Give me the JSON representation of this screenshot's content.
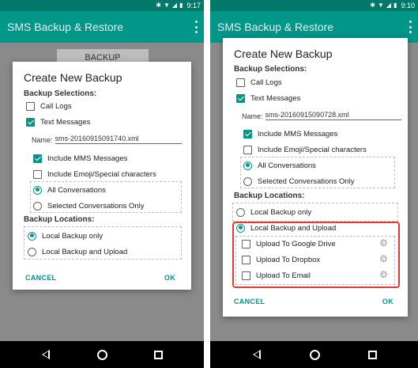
{
  "statusbar": {
    "left_time": "9:17",
    "right_time": "9:10"
  },
  "app": {
    "title": "SMS Backup & Restore",
    "behind_button": "BACKUP"
  },
  "dialog": {
    "title": "Create New Backup",
    "backup_selections": "Backup Selections:",
    "call_logs": "Call Logs",
    "text_messages": "Text Messages",
    "name_label": "Name:",
    "include_mms": "Include MMS Messages",
    "include_emoji": "Include Emoji/Special characters",
    "all_conversations": "All Conversations",
    "selected_conversations": "Selected Conversations Only",
    "backup_locations": "Backup Locations:",
    "local_backup_only": "Local Backup only",
    "local_backup_and_upload": "Local Backup and Upload",
    "upload_google_drive": "Upload To Google Drive",
    "upload_dropbox": "Upload To Dropbox",
    "upload_email": "Upload To Email",
    "cancel": "CANCEL",
    "ok": "OK"
  },
  "left": {
    "name_value": "sms-20160915091740.xml"
  },
  "right": {
    "name_value": "sms-20160915090728.xml"
  },
  "colors": {
    "accent": "#009688",
    "toolbar": "#009688",
    "statusbar": "#00796b",
    "highlight": "#e53935"
  },
  "icons": [
    "bluetooth-icon",
    "wifi-icon",
    "signal-icon",
    "battery-icon",
    "overflow-menu-icon",
    "gear-icon",
    "back-icon",
    "home-icon",
    "recents-icon"
  ]
}
